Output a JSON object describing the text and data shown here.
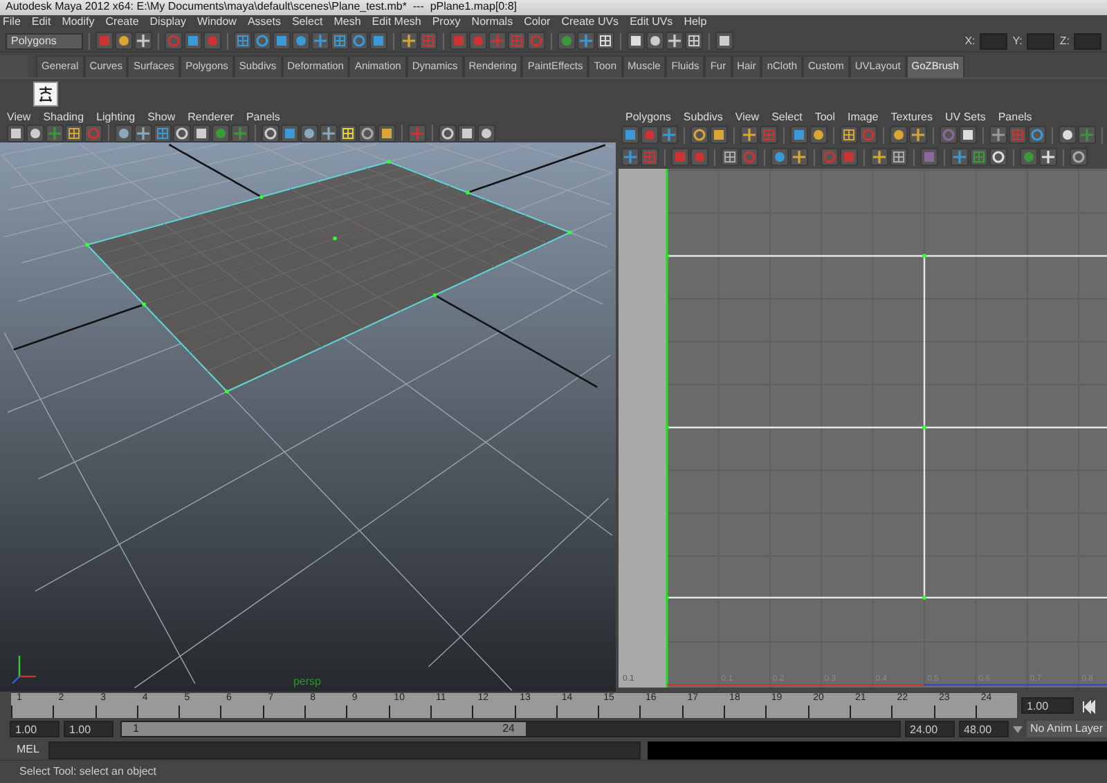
{
  "window": {
    "title": "Autodesk Maya 2012 x64: E:\\My Documents\\maya\\default\\scenes\\Plane_test.mb*  ---  pPlane1.map[0:8]"
  },
  "menu_bar": [
    "File",
    "Edit",
    "Modify",
    "Create",
    "Display",
    "Window",
    "Assets",
    "Select",
    "Mesh",
    "Edit Mesh",
    "Proxy",
    "Normals",
    "Color",
    "Create UVs",
    "Edit UVs",
    "Help"
  ],
  "status_line": {
    "mode": "Polygons",
    "coordinate_labels": [
      "X:",
      "Y:",
      "Z:"
    ]
  },
  "shelf": {
    "tabs": [
      {
        "label": "General",
        "selected": false
      },
      {
        "label": "Curves",
        "selected": false
      },
      {
        "label": "Surfaces",
        "selected": false
      },
      {
        "label": "Polygons",
        "selected": false
      },
      {
        "label": "Subdivs",
        "selected": false
      },
      {
        "label": "Deformation",
        "selected": false
      },
      {
        "label": "Animation",
        "selected": false
      },
      {
        "label": "Dynamics",
        "selected": false
      },
      {
        "label": "Rendering",
        "selected": false
      },
      {
        "label": "PaintEffects",
        "selected": false
      },
      {
        "label": "Toon",
        "selected": false
      },
      {
        "label": "Muscle",
        "selected": false
      },
      {
        "label": "Fluids",
        "selected": false
      },
      {
        "label": "Fur",
        "selected": false
      },
      {
        "label": "Hair",
        "selected": false
      },
      {
        "label": "nCloth",
        "selected": false
      },
      {
        "label": "Custom",
        "selected": false
      },
      {
        "label": "UVLayout",
        "selected": false
      },
      {
        "label": "GoZBrush",
        "selected": true
      }
    ]
  },
  "perspective_panel": {
    "menus": [
      "View",
      "Shading",
      "Lighting",
      "Show",
      "Renderer",
      "Panels"
    ],
    "camera_label": "persp"
  },
  "uv_editor": {
    "menus": [
      "Polygons",
      "Subdivs",
      "View",
      "Select",
      "Tool",
      "Image",
      "Textures",
      "UV Sets",
      "Panels"
    ],
    "u_labels": [
      "0.1",
      "0.1",
      "0.2",
      "0.3",
      "0.4",
      "0.5",
      "0.6",
      "0.7",
      "0.8"
    ]
  },
  "time_slider": {
    "frames": [
      "1",
      "2",
      "3",
      "4",
      "5",
      "6",
      "7",
      "8",
      "9",
      "10",
      "11",
      "12",
      "13",
      "14",
      "15",
      "16",
      "17",
      "18",
      "19",
      "20",
      "21",
      "22",
      "23",
      "24"
    ],
    "current_frame": "1.00"
  },
  "range_slider": {
    "start_time": "1.00",
    "playback_start": "1.00",
    "range_start": "1",
    "range_end": "24",
    "playback_end": "24.00",
    "end_time": "48.00",
    "anim_layer": "No Anim Layer"
  },
  "command_line": {
    "label": "MEL"
  },
  "help_line": "Select Tool: select an object"
}
